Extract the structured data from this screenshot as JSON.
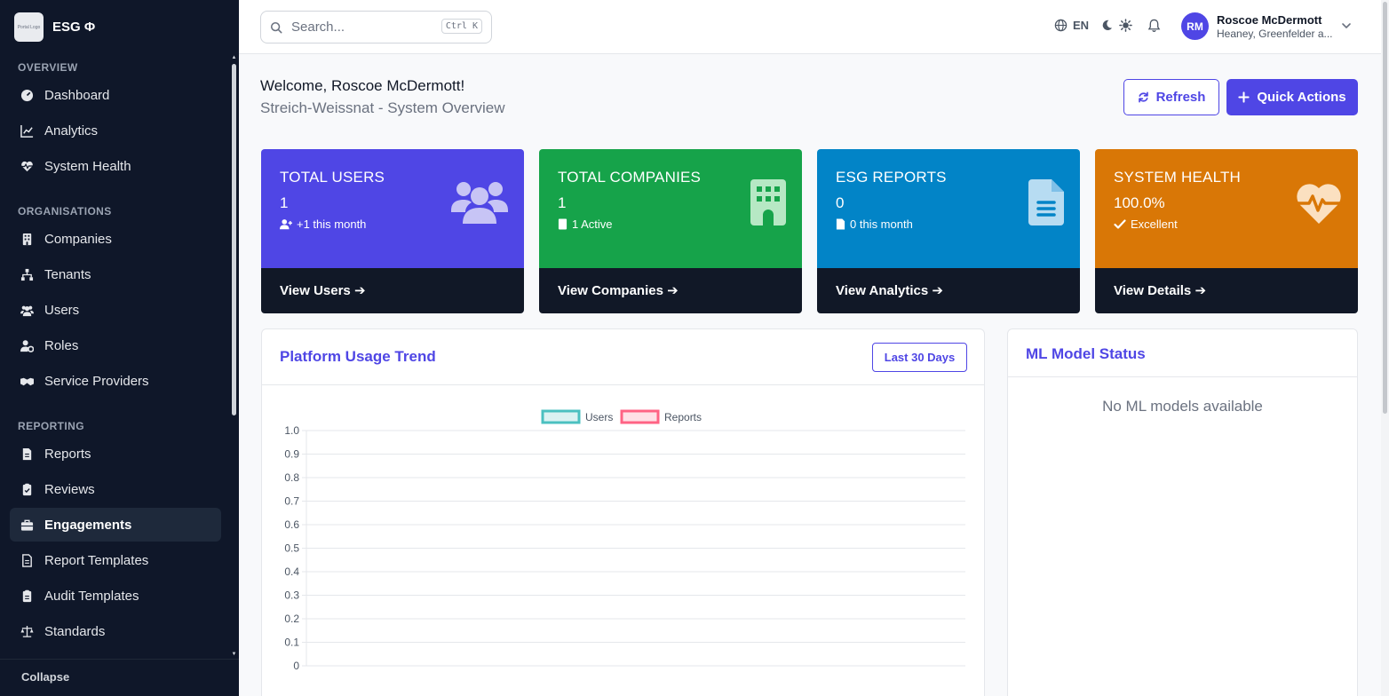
{
  "brand": {
    "name": "ESG Φ",
    "logo_text": "Portal Logo"
  },
  "sidebar": {
    "sections": [
      {
        "title": "OVERVIEW",
        "items": [
          {
            "label": "Dashboard",
            "icon": "dashboard-icon"
          },
          {
            "label": "Analytics",
            "icon": "analytics-icon"
          },
          {
            "label": "System Health",
            "icon": "heart-pulse-icon"
          }
        ]
      },
      {
        "title": "ORGANISATIONS",
        "items": [
          {
            "label": "Companies",
            "icon": "building-icon"
          },
          {
            "label": "Tenants",
            "icon": "sitemap-icon"
          },
          {
            "label": "Users",
            "icon": "users-icon"
          },
          {
            "label": "Roles",
            "icon": "user-gear-icon"
          },
          {
            "label": "Service Providers",
            "icon": "handshake-icon"
          }
        ]
      },
      {
        "title": "REPORTING",
        "items": [
          {
            "label": "Reports",
            "icon": "file-icon"
          },
          {
            "label": "Reviews",
            "icon": "clipboard-check-icon"
          },
          {
            "label": "Engagements",
            "icon": "briefcase-icon",
            "active": true
          },
          {
            "label": "Report Templates",
            "icon": "file-template-icon"
          },
          {
            "label": "Audit Templates",
            "icon": "clipboard-list-icon"
          },
          {
            "label": "Standards",
            "icon": "scale-icon"
          }
        ]
      }
    ],
    "collapse_label": "Collapse"
  },
  "topbar": {
    "search_placeholder": "Search...",
    "search_shortcut": "Ctrl K",
    "language": "EN",
    "user": {
      "initials": "RM",
      "name": "Roscoe McDermott",
      "org": "Heaney, Greenfelder a..."
    }
  },
  "header": {
    "welcome": "Welcome, Roscoe McDermott!",
    "subtitle": "Streich-Weissnat - System Overview",
    "refresh_label": "Refresh",
    "quick_actions_label": "Quick Actions"
  },
  "cards": [
    {
      "label": "TOTAL USERS",
      "value": "1",
      "meta": "+1 this month",
      "footer": "View Users",
      "color": "#4f46e5"
    },
    {
      "label": "TOTAL COMPANIES",
      "value": "1",
      "meta": "1 Active",
      "footer": "View Companies",
      "color": "#16a34a"
    },
    {
      "label": "ESG REPORTS",
      "value": "0",
      "meta": "0 this month",
      "footer": "View Analytics",
      "color": "#0284c7"
    },
    {
      "label": "SYSTEM HEALTH",
      "value": "100.0%",
      "meta": "Excellent",
      "footer": "View Details",
      "color": "#d97706"
    }
  ],
  "usage_panel": {
    "title": "Platform Usage Trend",
    "period_label": "Last 30 Days"
  },
  "chart_data": {
    "type": "line",
    "title": "",
    "xlabel": "",
    "ylabel": "",
    "x": [],
    "series": [
      {
        "name": "Users",
        "values": [],
        "color": "#4bc0c0"
      },
      {
        "name": "Reports",
        "values": [],
        "color": "#ff6384"
      }
    ],
    "ylim": [
      0,
      1.0
    ],
    "yticks": [
      "1.0",
      "0.9",
      "0.8",
      "0.7",
      "0.6",
      "0.5",
      "0.4",
      "0.3",
      "0.2",
      "0.1",
      "0"
    ],
    "grid": true,
    "legend": "top"
  },
  "ml_panel": {
    "title": "ML Model Status",
    "empty_text": "No ML models available"
  }
}
